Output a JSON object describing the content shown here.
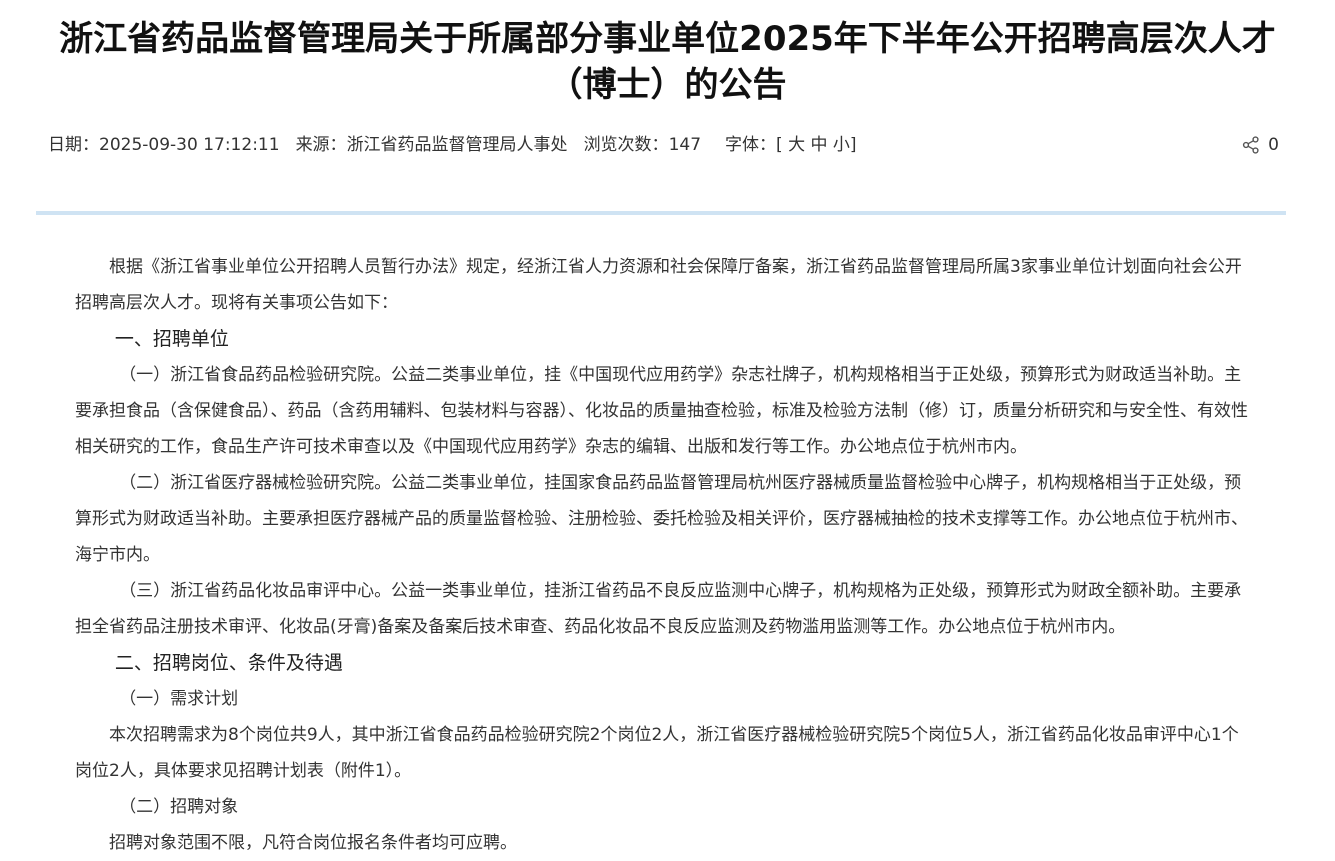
{
  "article": {
    "title": "浙江省药品监督管理局关于所属部分事业单位2025年下半年公开招聘高层次人才（博士）的公告",
    "meta": {
      "date_label": "日期：",
      "date_value": "2025-09-30 17:12:11",
      "source_label": "来源：",
      "source_value": "浙江省药品监督管理局人事处",
      "views_label": "浏览次数：",
      "views_value": "147",
      "font_label": "字体：",
      "font_open": "[",
      "font_large": "大",
      "font_medium": "中",
      "font_small": "小",
      "font_close": "]"
    },
    "share_count": "0",
    "paragraphs": [
      "根据《浙江省事业单位公开招聘人员暂行办法》规定，经浙江省人力资源和社会保障厅备案，浙江省药品监督管理局所属3家事业单位计划面向社会公开招聘高层次人才。现将有关事项公告如下：",
      "一、招聘单位",
      "（一）浙江省食品药品检验研究院。公益二类事业单位，挂《中国现代应用药学》杂志社牌子，机构规格相当于正处级，预算形式为财政适当补助。主要承担食品（含保健食品）、药品（含药用辅料、包装材料与容器）、化妆品的质量抽查检验，标准及检验方法制（修）订，质量分析研究和与安全性、有效性相关研究的工作，食品生产许可技术审查以及《中国现代应用药学》杂志的编辑、出版和发行等工作。办公地点位于杭州市内。",
      "（二）浙江省医疗器械检验研究院。公益二类事业单位，挂国家食品药品监督管理局杭州医疗器械质量监督检验中心牌子，机构规格相当于正处级，预算形式为财政适当补助。主要承担医疗器械产品的质量监督检验、注册检验、委托检验及相关评价，医疗器械抽检的技术支撑等工作。办公地点位于杭州市、海宁市内。",
      "（三）浙江省药品化妆品审评中心。公益一类事业单位，挂浙江省药品不良反应监测中心牌子，机构规格为正处级，预算形式为财政全额补助。主要承担全省药品注册技术审评、化妆品(牙膏)备案及备案后技术审查、药品化妆品不良反应监测及药物滥用监测等工作。办公地点位于杭州市内。",
      "二、招聘岗位、条件及待遇",
      "（一）需求计划",
      "本次招聘需求为8个岗位共9人，其中浙江省食品药品检验研究院2个岗位2人，浙江省医疗器械检验研究院5个岗位5人，浙江省药品化妆品审评中心1个岗位2人，具体要求见招聘计划表（附件1）。",
      "（二）招聘对象",
      "招聘对象范围不限，凡符合岗位报名条件者均可应聘。"
    ]
  },
  "colors": {
    "divider": "#cfe3f3",
    "title": "#111111",
    "body_text": "#333333"
  }
}
